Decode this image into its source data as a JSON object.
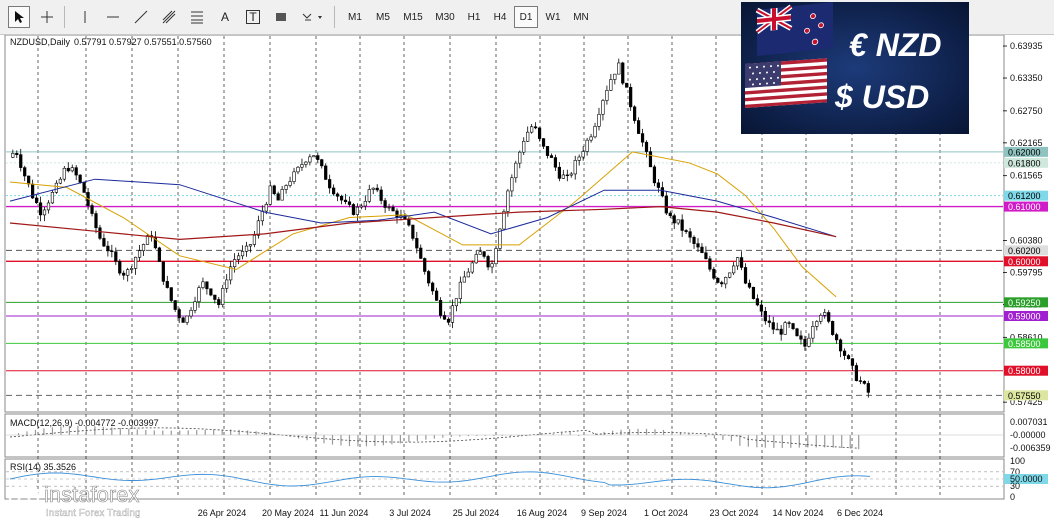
{
  "toolbar": {
    "timeframes": [
      "M1",
      "M5",
      "M15",
      "M30",
      "H1",
      "H4",
      "D1",
      "W1",
      "MN"
    ],
    "active_timeframe": "D1",
    "text_tool": "A",
    "label_tool": "T"
  },
  "chart_header": {
    "symbol": "NZDUSD,Daily",
    "ohlc": "0.57791 0.57927 0.57551 0.57560"
  },
  "banner": {
    "line1": "€ NZD",
    "line2": "$ USD"
  },
  "watermark": {
    "brand": "instaforex",
    "tagline": "Instant Forex Trading"
  },
  "price_axis": {
    "ticks": [
      "0.63935",
      "0.63350",
      "0.62750",
      "0.62165",
      "0.61565",
      "0.60380",
      "0.59795",
      "0.59210",
      "0.58610",
      "0.57425"
    ],
    "level_labels": [
      {
        "text": "0.62000",
        "color": "#8fc3c0"
      },
      {
        "text": "0.61800",
        "color": "#cfe8dd"
      },
      {
        "text": "0.61200",
        "color": "#7fd8e8"
      },
      {
        "text": "0.61000",
        "color": "#d01cc8"
      },
      {
        "text": "0.60200",
        "color": "#dddddd"
      },
      {
        "text": "0.60000",
        "color": "#e0102a"
      },
      {
        "text": "0.59250",
        "color": "#2aa02a"
      },
      {
        "text": "0.59000",
        "color": "#a020d0"
      },
      {
        "text": "0.58500",
        "color": "#3cc83c"
      },
      {
        "text": "0.58000",
        "color": "#e0102a"
      },
      {
        "text": "0.57550",
        "color": "#dde6a0"
      }
    ]
  },
  "date_axis": [
    "26 Apr 2024",
    "20 May 2024",
    "11 Jun 2024",
    "3 Jul 2024",
    "25 Jul 2024",
    "16 Aug 2024",
    "9 Sep 2024",
    "1 Oct 2024",
    "23 Oct 2024",
    "14 Nov 2024",
    "6 Dec 2024"
  ],
  "macd": {
    "label": "MACD(12,26,9) -0.004772 -0.003997",
    "ticks": [
      "0.007031",
      "-0.00000",
      "-0.006359"
    ]
  },
  "rsi": {
    "label": "RSI(14) 35.3526",
    "ticks": [
      "100",
      "70",
      "50.0000",
      "30",
      "0"
    ]
  },
  "chart_data": {
    "type": "candlestick",
    "symbol": "NZDUSD",
    "timeframe": "Daily",
    "ylim": [
      0.573,
      0.641
    ],
    "close_path": [
      [
        0,
        0.619
      ],
      [
        2,
        0.6205
      ],
      [
        5,
        0.616
      ],
      [
        8,
        0.612
      ],
      [
        11,
        0.609
      ],
      [
        14,
        0.6115
      ],
      [
        17,
        0.614
      ],
      [
        20,
        0.6175
      ],
      [
        23,
        0.616
      ],
      [
        26,
        0.613
      ],
      [
        29,
        0.608
      ],
      [
        32,
        0.604
      ],
      [
        35,
        0.602
      ],
      [
        38,
        0.599
      ],
      [
        41,
        0.5975
      ],
      [
        44,
        0.6005
      ],
      [
        47,
        0.603
      ],
      [
        50,
        0.605
      ],
      [
        53,
        0.599
      ],
      [
        56,
        0.594
      ],
      [
        59,
        0.5905
      ],
      [
        62,
        0.589
      ],
      [
        65,
        0.593
      ],
      [
        68,
        0.596
      ],
      [
        71,
        0.5945
      ],
      [
        74,
        0.592
      ],
      [
        77,
        0.598
      ],
      [
        80,
        0.601
      ],
      [
        83,
        0.6015
      ],
      [
        86,
        0.604
      ],
      [
        89,
        0.609
      ],
      [
        92,
        0.613
      ],
      [
        95,
        0.611
      ],
      [
        98,
        0.6145
      ],
      [
        101,
        0.616
      ],
      [
        104,
        0.6185
      ],
      [
        107,
        0.62
      ],
      [
        110,
        0.617
      ],
      [
        113,
        0.614
      ],
      [
        116,
        0.612
      ],
      [
        119,
        0.61
      ],
      [
        122,
        0.609
      ],
      [
        125,
        0.611
      ],
      [
        128,
        0.6135
      ],
      [
        131,
        0.6115
      ],
      [
        134,
        0.6095
      ],
      [
        137,
        0.6085
      ],
      [
        140,
        0.607
      ],
      [
        143,
        0.604
      ],
      [
        146,
        0.599
      ],
      [
        149,
        0.595
      ],
      [
        152,
        0.591
      ],
      [
        155,
        0.5895
      ],
      [
        158,
        0.594
      ],
      [
        161,
        0.5975
      ],
      [
        164,
        0.6
      ],
      [
        167,
        0.602
      ],
      [
        170,
        0.5985
      ],
      [
        173,
        0.606
      ],
      [
        176,
        0.613
      ],
      [
        179,
        0.618
      ],
      [
        182,
        0.623
      ],
      [
        185,
        0.625
      ],
      [
        188,
        0.621
      ],
      [
        191,
        0.619
      ],
      [
        194,
        0.616
      ],
      [
        197,
        0.615
      ],
      [
        200,
        0.618
      ],
      [
        203,
        0.621
      ],
      [
        206,
        0.624
      ],
      [
        209,
        0.629
      ],
      [
        212,
        0.633
      ],
      [
        215,
        0.636
      ],
      [
        218,
        0.631
      ],
      [
        221,
        0.626
      ],
      [
        224,
        0.621
      ],
      [
        227,
        0.616
      ],
      [
        230,
        0.612
      ],
      [
        233,
        0.608
      ],
      [
        236,
        0.607
      ],
      [
        239,
        0.605
      ],
      [
        242,
        0.603
      ],
      [
        245,
        0.601
      ],
      [
        248,
        0.598
      ],
      [
        251,
        0.596
      ],
      [
        254,
        0.598
      ],
      [
        257,
        0.601
      ],
      [
        260,
        0.596
      ],
      [
        263,
        0.593
      ],
      [
        266,
        0.59
      ],
      [
        269,
        0.588
      ],
      [
        272,
        0.587
      ],
      [
        275,
        0.5885
      ],
      [
        278,
        0.586
      ],
      [
        281,
        0.5845
      ],
      [
        284,
        0.589
      ],
      [
        287,
        0.591
      ],
      [
        290,
        0.588
      ],
      [
        293,
        0.585
      ],
      [
        296,
        0.582
      ],
      [
        299,
        0.579
      ],
      [
        302,
        0.577
      ],
      [
        304,
        0.5756
      ]
    ],
    "ma_fast": [
      [
        0,
        0.6145
      ],
      [
        20,
        0.6135
      ],
      [
        40,
        0.608
      ],
      [
        60,
        0.601
      ],
      [
        80,
        0.5985
      ],
      [
        100,
        0.605
      ],
      [
        120,
        0.608
      ],
      [
        140,
        0.6085
      ],
      [
        160,
        0.603
      ],
      [
        180,
        0.603
      ],
      [
        200,
        0.611
      ],
      [
        220,
        0.62
      ],
      [
        240,
        0.618
      ],
      [
        250,
        0.616
      ],
      [
        260,
        0.612
      ],
      [
        270,
        0.606
      ],
      [
        280,
        0.599
      ],
      [
        292,
        0.5935
      ]
    ],
    "ma_mid": [
      [
        0,
        0.611
      ],
      [
        30,
        0.615
      ],
      [
        60,
        0.614
      ],
      [
        90,
        0.609
      ],
      [
        110,
        0.607
      ],
      [
        130,
        0.6075
      ],
      [
        150,
        0.609
      ],
      [
        170,
        0.605
      ],
      [
        190,
        0.608
      ],
      [
        210,
        0.613
      ],
      [
        230,
        0.613
      ],
      [
        250,
        0.611
      ],
      [
        270,
        0.608
      ],
      [
        292,
        0.6045
      ]
    ],
    "ma_slow": [
      [
        0,
        0.607
      ],
      [
        30,
        0.6055
      ],
      [
        60,
        0.604
      ],
      [
        90,
        0.605
      ],
      [
        120,
        0.607
      ],
      [
        150,
        0.608
      ],
      [
        180,
        0.609
      ],
      [
        210,
        0.6095
      ],
      [
        230,
        0.61
      ],
      [
        250,
        0.609
      ],
      [
        270,
        0.607
      ],
      [
        292,
        0.6045
      ]
    ],
    "levels": [
      0.62,
      0.618,
      0.612,
      0.61,
      0.602,
      0.6,
      0.5925,
      0.59,
      0.585,
      0.58,
      0.5755
    ],
    "date_ticks": [
      "26 Apr 2024",
      "20 May 2024",
      "11 Jun 2024",
      "3 Jul 2024",
      "25 Jul 2024",
      "16 Aug 2024",
      "9 Sep 2024",
      "1 Oct 2024",
      "23 Oct 2024",
      "14 Nov 2024",
      "6 Dec 2024"
    ]
  }
}
